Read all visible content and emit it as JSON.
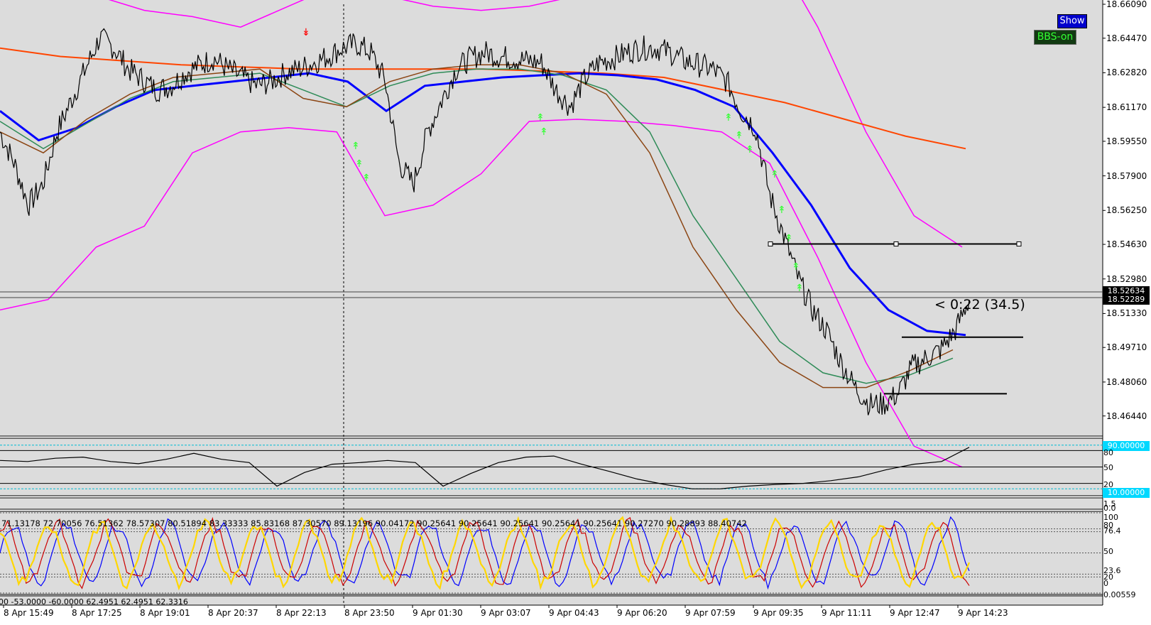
{
  "chart_data": {
    "type": "line",
    "symbol_hint": "USDMXN-like intraday",
    "price_axis": {
      "ticks": [
        "18.66090",
        "18.64470",
        "18.62820",
        "18.61170",
        "18.59550",
        "18.57900",
        "18.56250",
        "18.54630",
        "18.52980",
        "18.51330",
        "18.49710",
        "18.48060",
        "18.46440"
      ],
      "ylim": [
        18.4548,
        18.6609
      ]
    },
    "price_badges": [
      "18.52634",
      "18.52289"
    ],
    "time_axis": {
      "labels": [
        "8 Apr 15:49",
        "8 Apr 17:25",
        "8 Apr 19:01",
        "8 Apr 20:37",
        "8 Apr 22:13",
        "8 Apr 23:50",
        "9 Apr 01:30",
        "9 Apr 03:07",
        "9 Apr 04:43",
        "9 Apr 06:20",
        "9 Apr 07:59",
        "9 Apr 09:35",
        "9 Apr 11:11",
        "9 Apr 12:47",
        "9 Apr 14:23"
      ]
    },
    "price_series": {
      "name": "",
      "values": [
        18.6,
        18.585,
        18.565,
        18.575,
        18.6,
        18.615,
        18.63,
        18.645,
        18.64,
        18.63,
        18.625,
        18.62,
        18.622,
        18.628,
        18.632,
        18.635,
        18.63,
        18.626,
        18.622,
        18.624,
        18.628,
        18.63,
        18.633,
        18.636,
        18.64,
        18.642,
        18.638,
        18.625,
        18.585,
        18.575,
        18.6,
        18.615,
        18.63,
        18.635,
        18.638,
        18.636,
        18.635,
        18.634,
        18.633,
        18.62,
        18.612,
        18.625,
        18.633,
        18.635,
        18.638,
        18.64,
        18.64,
        18.638,
        18.634,
        18.632,
        18.63,
        18.624,
        18.61,
        18.602,
        18.57,
        18.55,
        18.53,
        18.515,
        18.505,
        18.49,
        18.478,
        18.47,
        18.47,
        18.475,
        18.488,
        18.492,
        18.496,
        18.505,
        18.52
      ],
      "color": "#000000"
    },
    "moving_averages": [
      {
        "color": "#ff4500",
        "values": [
          18.64,
          18.636,
          18.634,
          18.632,
          18.631,
          18.63,
          18.63,
          18.63,
          18.63,
          18.629,
          18.628,
          18.626,
          18.62,
          18.614,
          18.606,
          18.598,
          18.592
        ]
      },
      {
        "color": "#0000ff",
        "values": [
          18.61,
          18.596,
          18.602,
          18.612,
          18.62,
          18.622,
          18.624,
          18.626,
          18.628,
          18.624,
          18.61,
          18.622,
          18.624,
          18.626,
          18.627,
          18.628,
          18.627,
          18.625,
          18.62,
          18.612,
          18.59,
          18.565,
          18.535,
          18.515,
          18.505,
          18.503
        ]
      },
      {
        "color": "#2e8b57",
        "values": [
          18.605,
          18.592,
          18.604,
          18.616,
          18.624,
          18.626,
          18.628,
          18.62,
          18.612,
          18.622,
          18.628,
          18.63,
          18.63,
          18.627,
          18.62,
          18.6,
          18.56,
          18.53,
          18.5,
          18.485,
          18.48,
          18.484,
          18.492
        ]
      },
      {
        "color": "#8b4513",
        "values": [
          18.6,
          18.59,
          18.606,
          18.618,
          18.626,
          18.628,
          18.63,
          18.616,
          18.612,
          18.624,
          18.63,
          18.632,
          18.632,
          18.628,
          18.618,
          18.59,
          18.545,
          18.515,
          18.49,
          18.478,
          18.478,
          18.486,
          18.496
        ]
      }
    ],
    "bollinger_outer": {
      "color": "#ff00ff",
      "upper": [
        18.68,
        18.672,
        18.665,
        18.658,
        18.655,
        18.65,
        18.66,
        18.67,
        18.665,
        18.66,
        18.658,
        18.66,
        18.665,
        18.668,
        18.672,
        18.68,
        18.69,
        18.65,
        18.6,
        18.56,
        18.545
      ],
      "lower": [
        18.515,
        18.52,
        18.545,
        18.555,
        18.59,
        18.6,
        18.602,
        18.6,
        18.56,
        18.565,
        18.58,
        18.605,
        18.606,
        18.605,
        18.603,
        18.6,
        18.585,
        18.54,
        18.49,
        18.45,
        18.44
      ]
    },
    "horizontal_levels": [
      18.5465,
      18.502,
      18.475
    ],
    "rsi": {
      "levels": [
        10,
        20,
        50,
        80,
        90
      ],
      "values": [
        62,
        60,
        66,
        68,
        60,
        56,
        64,
        75,
        64,
        58,
        15,
        40,
        55,
        58,
        62,
        58,
        15,
        38,
        58,
        68,
        70,
        55,
        42,
        28,
        18,
        10,
        10,
        15,
        18,
        20,
        25,
        32,
        45,
        55,
        60,
        86
      ]
    },
    "stoch": {
      "levels": [
        0,
        20,
        23.6,
        50,
        76.4,
        80,
        100
      ],
      "header_values": "71.13178 72.70056 76.51362 78.57307 80.51894 83.33333 85.83168 87.30570 89.13196 90.04172 90.25641 90.25641 90.25641 90.25641 90.25641 90.27270 90.28893 88.40742",
      "footer_values": "00 -53.0000 -60.0000 62.4951 62.4951 62.3316"
    },
    "rsi_labels": {
      "top": "90.00000",
      "mid80": "80",
      "mid50": "50",
      "mid20": "20",
      "bottom": "10.00000"
    },
    "aux_labels": {
      "a": "1.5",
      "b": "0.0"
    },
    "stoch_labels": {
      "l100": "100",
      "l80": "80",
      "l76": "76.4",
      "l50": "50",
      "l23": "23.6",
      "l20": "20",
      "l0": "0",
      "bottom": "0.00559"
    }
  },
  "ui": {
    "show_button": "Show",
    "bbs_button": "BBS-on",
    "countdown": "< 0:22 (34.5)"
  }
}
